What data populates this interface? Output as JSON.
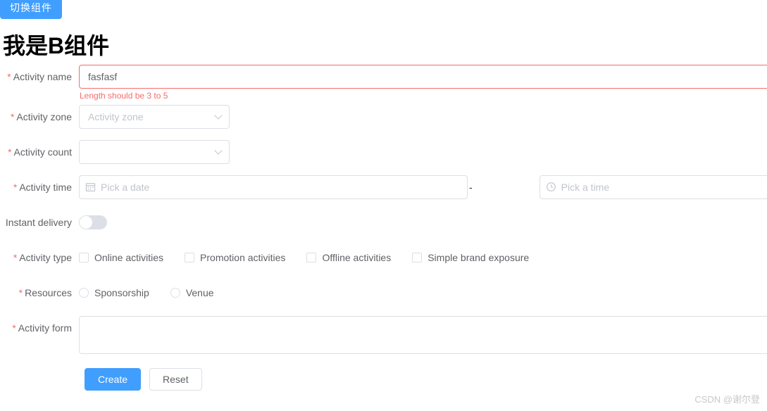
{
  "header": {
    "switch_button_label": "切换组件",
    "page_title": "我是B组件"
  },
  "form": {
    "rows": {
      "activity_name": {
        "label": "Activity name",
        "required": true,
        "value": "fasfasf",
        "placeholder": "",
        "error": "Length should be 3 to 5"
      },
      "activity_zone": {
        "label": "Activity zone",
        "required": true,
        "value": "",
        "placeholder": "Activity zone",
        "chevron_icon": "chevron-down-icon"
      },
      "activity_count": {
        "label": "Activity count",
        "required": true,
        "value": "",
        "placeholder": "",
        "chevron_icon": "chevron-down-icon"
      },
      "activity_time": {
        "label": "Activity time",
        "required": true,
        "date_placeholder": "Pick a date",
        "date_value": "",
        "date_icon": "calendar-icon",
        "separator": "-",
        "time_placeholder": "Pick a time",
        "time_value": "",
        "time_icon": "clock-icon"
      },
      "instant_delivery": {
        "label": "Instant delivery",
        "required": false,
        "checked": false
      },
      "activity_type": {
        "label": "Activity type",
        "required": true,
        "options": [
          {
            "label": "Online activities",
            "checked": false
          },
          {
            "label": "Promotion activities",
            "checked": false
          },
          {
            "label": "Offline activities",
            "checked": false
          },
          {
            "label": "Simple brand exposure",
            "checked": false
          }
        ]
      },
      "resources": {
        "label": "Resources",
        "required": true,
        "options": [
          {
            "label": "Sponsorship",
            "checked": false
          },
          {
            "label": "Venue",
            "checked": false
          }
        ]
      },
      "activity_form": {
        "label": "Activity form",
        "required": true,
        "value": "",
        "placeholder": ""
      }
    },
    "buttons": {
      "submit_label": "Create",
      "reset_label": "Reset"
    }
  },
  "watermark": "CSDN @谢尔登",
  "colors": {
    "primary": "#409eff",
    "danger": "#f56c6c",
    "border": "#dcdfe6",
    "text": "#606266",
    "placeholder": "#c0c4cc"
  }
}
